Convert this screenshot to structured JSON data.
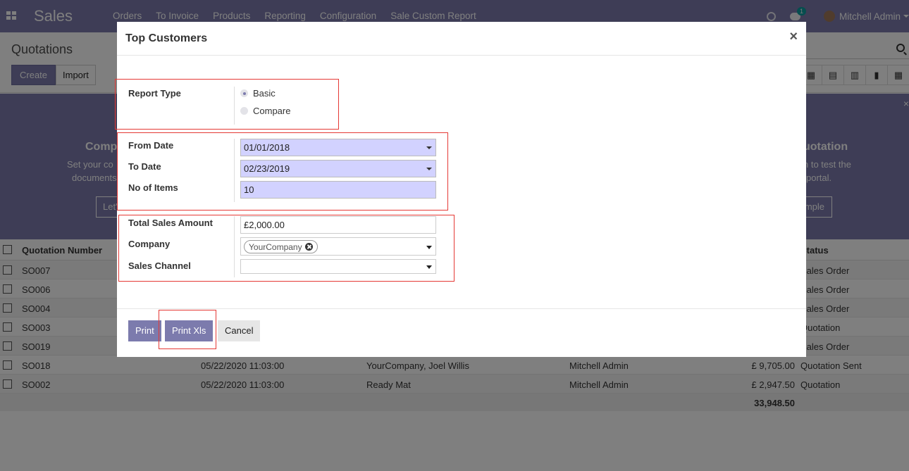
{
  "topbar": {
    "app_name": "Sales",
    "menu": [
      "Orders",
      "To Invoice",
      "Products",
      "Reporting",
      "Configuration",
      "Sale Custom Report"
    ],
    "chat_count": "1",
    "user_name": "Mitchell Admin"
  },
  "control": {
    "breadcrumb": "Quotations",
    "create_label": "Create",
    "import_label": "Import"
  },
  "banner": {
    "left_title": "Comp",
    "left_text1": "Set your co",
    "left_text2": "documents",
    "left_btn": "Let'",
    "right_title": "uotation",
    "right_text1": "n to test the",
    "right_text2": "portal.",
    "right_btn": "mple",
    "close": "×"
  },
  "list": {
    "columns": {
      "number": "Quotation Number",
      "status": "Status"
    },
    "rows": [
      {
        "number": "SO007",
        "date": "",
        "customer": "",
        "salesperson": "",
        "total": "",
        "status": "Sales Order"
      },
      {
        "number": "SO006",
        "date": "",
        "customer": "",
        "salesperson": "",
        "total": "",
        "status": "Sales Order"
      },
      {
        "number": "SO004",
        "date": "",
        "customer": "",
        "salesperson": "",
        "total": "",
        "status": "Sales Order"
      },
      {
        "number": "SO003",
        "date": "",
        "customer": "",
        "salesperson": "",
        "total": "",
        "status": "Quotation"
      },
      {
        "number": "SO019",
        "date": "",
        "customer": "",
        "salesperson": "",
        "total": "",
        "status": "Sales Order"
      },
      {
        "number": "SO018",
        "date": "05/22/2020 11:03:00",
        "customer": "YourCompany, Joel Willis",
        "salesperson": "Mitchell Admin",
        "total": "£ 9,705.00",
        "status": "Quotation Sent"
      },
      {
        "number": "SO002",
        "date": "05/22/2020 11:03:00",
        "customer": "Ready Mat",
        "salesperson": "Mitchell Admin",
        "total": "£ 2,947.50",
        "status": "Quotation"
      }
    ],
    "footer_total": "33,948.50"
  },
  "modal": {
    "title": "Top Customers",
    "close": "×",
    "report_type": {
      "label": "Report Type",
      "options": [
        {
          "label": "Basic",
          "selected": true
        },
        {
          "label": "Compare",
          "selected": false
        }
      ]
    },
    "from_date": {
      "label": "From Date",
      "value": "01/01/2018"
    },
    "to_date": {
      "label": "To Date",
      "value": "02/23/2019"
    },
    "no_of_items": {
      "label": "No of Items",
      "value": "10"
    },
    "total_sales": {
      "label": "Total Sales Amount",
      "value": "£2,000.00"
    },
    "company": {
      "label": "Company",
      "tag": "YourCompany"
    },
    "sales_channel": {
      "label": "Sales Channel",
      "value": ""
    },
    "buttons": {
      "print": "Print",
      "print_xls": "Print Xls",
      "cancel": "Cancel"
    }
  },
  "colors": {
    "brand": "#7c7bad",
    "highlight": "#e53935",
    "required_field": "#d2d2ff"
  }
}
